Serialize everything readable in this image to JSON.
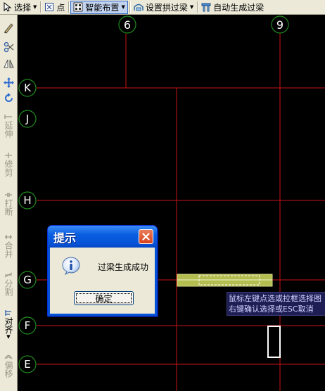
{
  "toolbar": {
    "select_label": "选择",
    "point_label": "点",
    "smart_layout_label": "智能布置",
    "set_arch_beam_label": "设置拱过梁",
    "auto_lintel_label": "自动生成过梁"
  },
  "left_tools": {
    "extend_label": "延伸",
    "trim_label": "修剪",
    "break_label": "打断",
    "merge_label": "合并",
    "split_label": "分割",
    "align_label": "对齐",
    "offset_label": "偏移"
  },
  "grid_axes": {
    "vertical": [
      "6",
      "9"
    ],
    "horizontal": [
      "K",
      "J",
      "H",
      "G",
      "F",
      "E"
    ]
  },
  "tooltip": {
    "line1": "鼠标左键点选或拉框选择图",
    "line2": "右键确认选择或ESC取消"
  },
  "dialog": {
    "title": "提示",
    "message": "过梁生成成功",
    "ok_label": "确定"
  },
  "colors": {
    "canvas_bg": "#000000",
    "grid_line": "#c81414",
    "axis_bubble": "#1f8a1f",
    "lintel_fill": "#b4be50",
    "selection_box": "#ffffff"
  }
}
